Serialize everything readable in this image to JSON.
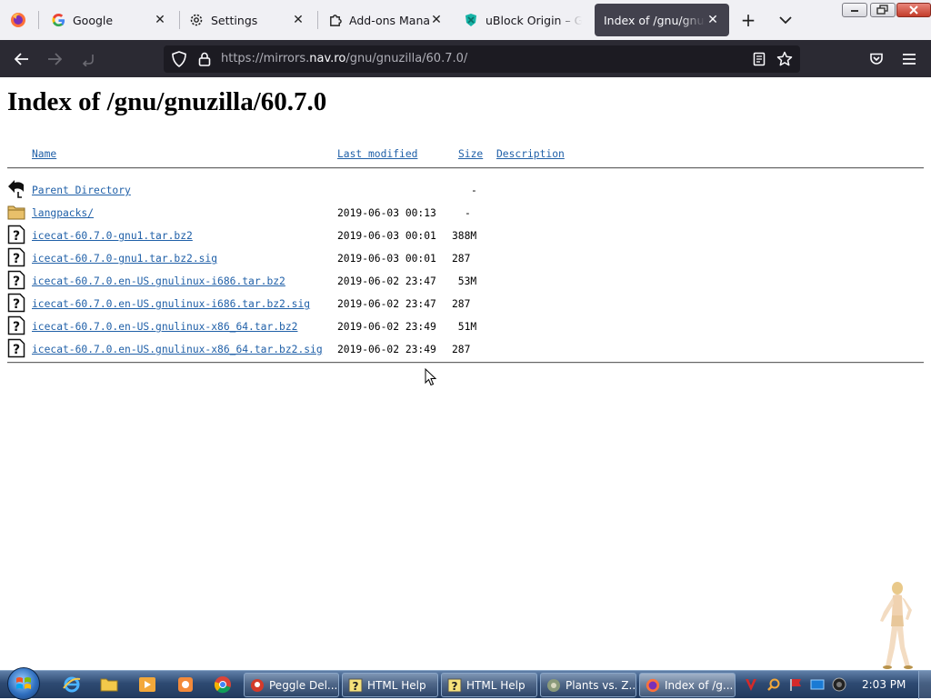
{
  "browser": {
    "tabs": [
      {
        "title": "Google",
        "icon": "google-icon"
      },
      {
        "title": "Settings",
        "icon": "gear-icon"
      },
      {
        "title": "Add-ons Manager",
        "icon": "puzzle-icon"
      },
      {
        "title": "uBlock Origin – Ge",
        "icon": "ublock-icon"
      },
      {
        "title": "Index of /gnu/gnuzilla",
        "icon": "none",
        "active": true
      }
    ],
    "url": {
      "scheme": "https://",
      "prefix": "mirrors.",
      "host": "nav.ro",
      "path": "/gnu/gnuzilla/60.7.0/"
    }
  },
  "page": {
    "title": "Index of /gnu/gnuzilla/60.7.0",
    "columns": {
      "name": "Name",
      "modified": "Last modified",
      "size": "Size",
      "description": "Description"
    },
    "rows": [
      {
        "name": "Parent Directory",
        "modified": "",
        "size": "-",
        "icon": "back-arrow-icon"
      },
      {
        "name": "langpacks/",
        "modified": "2019-06-03 00:13",
        "size": "-",
        "icon": "folder-icon"
      },
      {
        "name": "icecat-60.7.0-gnu1.tar.bz2",
        "modified": "2019-06-03 00:01",
        "size": "388M",
        "icon": "unknown-file-icon"
      },
      {
        "name": "icecat-60.7.0-gnu1.tar.bz2.sig",
        "modified": "2019-06-03 00:01",
        "size": "287",
        "icon": "unknown-file-icon"
      },
      {
        "name": "icecat-60.7.0.en-US.gnulinux-i686.tar.bz2",
        "modified": "2019-06-02 23:47",
        "size": " 53M",
        "icon": "unknown-file-icon"
      },
      {
        "name": "icecat-60.7.0.en-US.gnulinux-i686.tar.bz2.sig",
        "modified": "2019-06-02 23:47",
        "size": "287",
        "icon": "unknown-file-icon"
      },
      {
        "name": "icecat-60.7.0.en-US.gnulinux-x86_64.tar.bz2",
        "modified": "2019-06-02 23:49",
        "size": " 51M",
        "icon": "unknown-file-icon"
      },
      {
        "name": "icecat-60.7.0.en-US.gnulinux-x86_64.tar.bz2.sig",
        "modified": "2019-06-02 23:49",
        "size": "287",
        "icon": "unknown-file-icon"
      }
    ]
  },
  "taskbar": {
    "windows": [
      {
        "label": "Peggle Del...",
        "icon": "peggle-icon"
      },
      {
        "label": "HTML Help",
        "icon": "help-icon"
      },
      {
        "label": "HTML Help",
        "icon": "help-icon"
      },
      {
        "label": "Plants vs. Z...",
        "icon": "plants-icon"
      },
      {
        "label": "Index of /g...",
        "icon": "firefox-icon",
        "active": true
      }
    ],
    "clock": "2:03 PM"
  },
  "colors": {
    "link": "#2060a8",
    "active_tab": "#42414d",
    "navbar": "#2b2a33",
    "urlbar": "#1c1b22"
  }
}
